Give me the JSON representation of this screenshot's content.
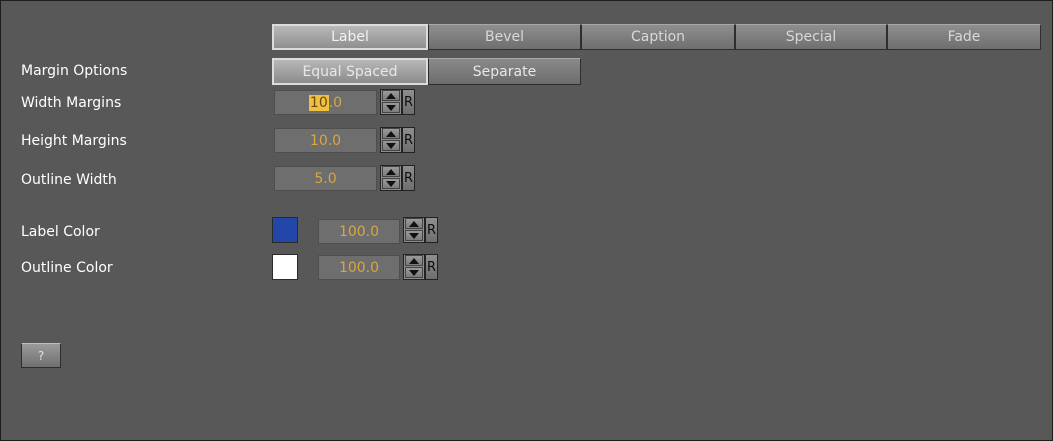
{
  "tabs": [
    "Label",
    "Bevel",
    "Caption",
    "Special",
    "Fade"
  ],
  "active_tab": "Label",
  "margin_options": {
    "label": "Margin Options",
    "options": [
      "Equal Spaced",
      "Separate"
    ],
    "selected": "Equal Spaced"
  },
  "width_margins": {
    "label": "Width Margins",
    "value_selected": "10",
    "value_rest": ".0",
    "reset": "R"
  },
  "height_margins": {
    "label": "Height Margins",
    "value": "10.0",
    "reset": "R"
  },
  "outline_width": {
    "label": "Outline Width",
    "value": "5.0",
    "reset": "R"
  },
  "label_color": {
    "label": "Label Color",
    "swatch": "#2347a8",
    "value": "100.0",
    "reset": "R"
  },
  "outline_color": {
    "label": "Outline Color",
    "swatch": "#ffffff",
    "value": "100.0",
    "reset": "R"
  },
  "help_button": {
    "label": "?"
  },
  "icons": {
    "spin": "spinner-arrows-icon"
  }
}
